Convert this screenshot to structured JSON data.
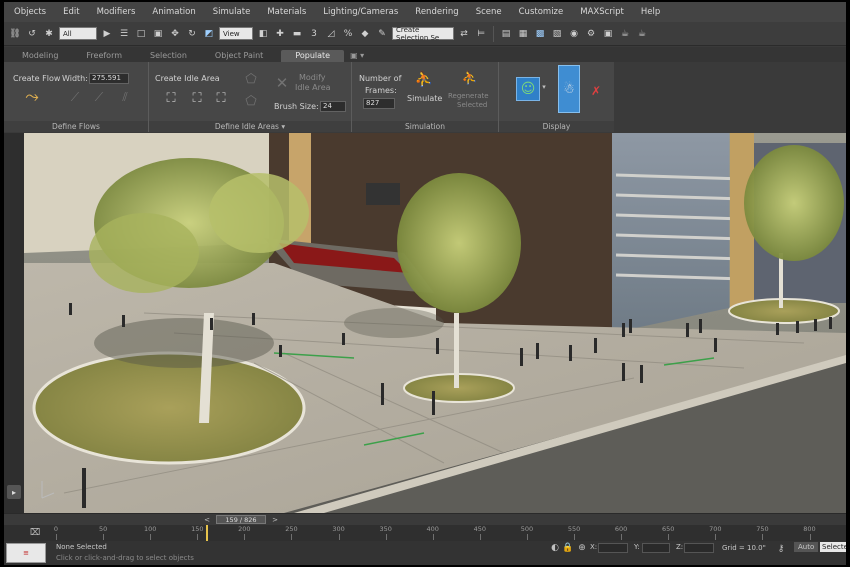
{
  "menu": [
    "Objects",
    "Edit",
    "Modifiers",
    "Animation",
    "Simulate",
    "Materials",
    "Lighting/Cameras",
    "Rendering",
    "Scene",
    "Customize",
    "MAXScript",
    "Help"
  ],
  "toolbar": {
    "filter_value": "All",
    "view_value": "View",
    "selection_set_value": "Create Selection Se"
  },
  "ribbon_tabs": [
    "Modeling",
    "Freeform",
    "Selection",
    "Object Paint",
    "Populate"
  ],
  "ribbon": {
    "flows": {
      "create_flow": "Create Flow",
      "width_label": "Width:",
      "width_value": "275.591",
      "footer": "Define Flows"
    },
    "idle": {
      "create_idle_area": "Create Idle Area",
      "modify_idle_area_line1": "Modify",
      "modify_idle_area_line2": "Idle Area",
      "brush_size_label": "Brush Size:",
      "brush_size_value": "24",
      "footer": "Define Idle Areas"
    },
    "simulation": {
      "number_of_label_1": "Number of",
      "frames_label": "Frames:",
      "frames_value": "827",
      "simulate": "Simulate",
      "regenerate_line1": "Regenerate",
      "regenerate_line2": "Selected",
      "footer": "Simulation"
    },
    "display": {
      "footer": "Display"
    }
  },
  "timeline": {
    "frame_readout": "159 / 826",
    "current_frame": 159,
    "total_frames": 826,
    "ticks": [
      "0",
      "50",
      "100",
      "150",
      "200",
      "250",
      "300",
      "350",
      "400",
      "450",
      "500",
      "550",
      "600",
      "650",
      "700",
      "750",
      "800"
    ]
  },
  "status": {
    "selection_text": "None Selected",
    "grid_text": "Grid = 10.0\"",
    "auto_label": "Auto",
    "selected_label": "Selected",
    "prompt_text": "Click or click-and-drag to select objects"
  },
  "colors": {
    "menu_bg": "#444444",
    "ribbon_bg": "#474747",
    "playhead": "#e6c34c"
  }
}
